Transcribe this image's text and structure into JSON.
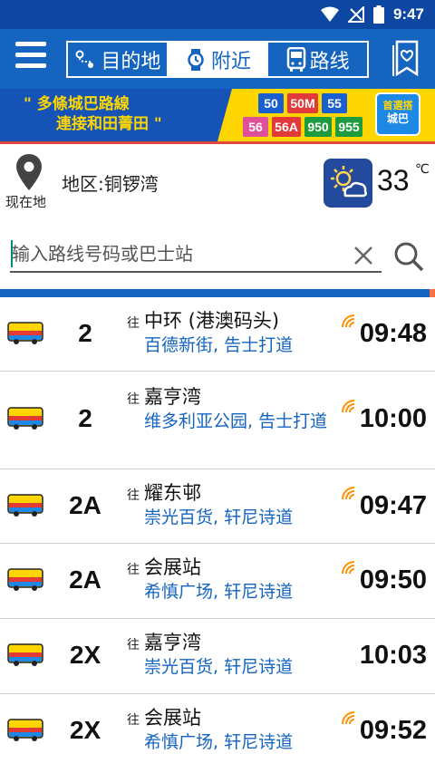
{
  "status_bar": {
    "time": "9:47"
  },
  "app_bar": {
    "tabs": [
      {
        "label": "目的地",
        "icon": "destination-icon",
        "active": false
      },
      {
        "label": "附近",
        "icon": "nearby-watch-icon",
        "active": true
      },
      {
        "label": "路线",
        "icon": "bus-route-icon",
        "active": false
      }
    ]
  },
  "banner": {
    "slogan_line1": "\" 多條城巴路線",
    "slogan_line2": "連接和田菁田 \"",
    "routes_row1": [
      "50",
      "50M",
      "55"
    ],
    "routes_row2": [
      "56",
      "56A",
      "950",
      "955"
    ],
    "brand_line1": "首選搭",
    "brand_line2": "城巴"
  },
  "location": {
    "caption": "现在地",
    "region": "地区:铜锣湾",
    "temperature": "33",
    "temperature_unit": "℃"
  },
  "search": {
    "placeholder": "输入路线号码或巴士站"
  },
  "eta_list": [
    {
      "route": "2",
      "prefix": "往",
      "destination": "中环 (港澳码头)",
      "stop": "百德新街, 告士打道",
      "eta": "09:48",
      "realtime": true
    },
    {
      "route": "2",
      "prefix": "往",
      "destination": "嘉亨湾",
      "stop": "维多利亚公园, 告士打道",
      "eta": "10:00",
      "realtime": true
    },
    {
      "route": "2A",
      "prefix": "往",
      "destination": "耀东邨",
      "stop": "崇光百货, 轩尼诗道",
      "eta": "09:47",
      "realtime": true
    },
    {
      "route": "2A",
      "prefix": "往",
      "destination": "会展站",
      "stop": "希慎广场, 轩尼诗道",
      "eta": "09:50",
      "realtime": true
    },
    {
      "route": "2X",
      "prefix": "往",
      "destination": "嘉亨湾",
      "stop": "崇光百货, 轩尼诗道",
      "eta": "10:03",
      "realtime": false
    },
    {
      "route": "2X",
      "prefix": "往",
      "destination": "会展站",
      "stop": "希慎广场, 轩尼诗道",
      "eta": "09:52",
      "realtime": true
    }
  ],
  "colors": {
    "primary": "#1565c0",
    "status_bar": "#0d47a1",
    "accent_yellow": "#ffd600",
    "stop_text": "#1565c0",
    "realtime": "#ff8f00"
  }
}
